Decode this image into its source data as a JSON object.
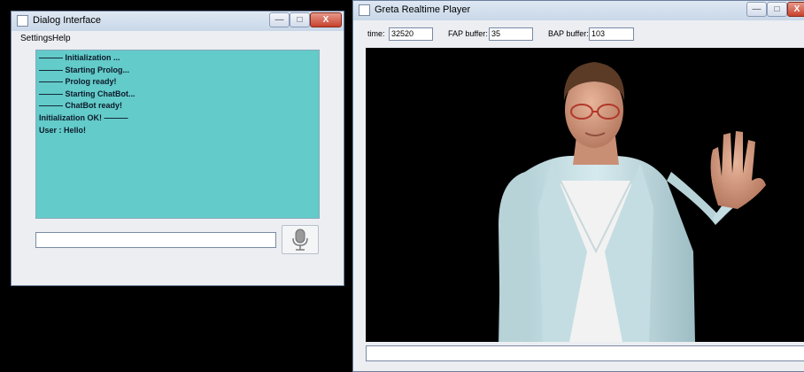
{
  "dialog": {
    "title": "Dialog Interface",
    "menu": [
      "Settings",
      "Help"
    ],
    "log": [
      "——— Initialization ...",
      "——— Starting Prolog...",
      "——— Prolog ready!",
      "——— Starting ChatBot...",
      "——— ChatBot ready!",
      "Initialization OK! ———",
      "User : Hello!"
    ],
    "input_value": "",
    "controls": {
      "minimize": "—",
      "maximize": "□",
      "close": "X"
    },
    "mic_icon": "microphone-icon"
  },
  "player": {
    "title": "Greta Realtime Player",
    "stats": [
      {
        "label": "time:",
        "value": "32520"
      },
      {
        "label": "FAP buffer:",
        "value": "35"
      },
      {
        "label": "BAP buffer:",
        "value": "103"
      }
    ],
    "input_value": "",
    "controls": {
      "minimize": "—",
      "maximize": "□",
      "close": "X"
    }
  },
  "colors": {
    "chat_bg": "#63cbc9",
    "title_bar": "#c9d7e8",
    "close_button": "#c8412c"
  }
}
